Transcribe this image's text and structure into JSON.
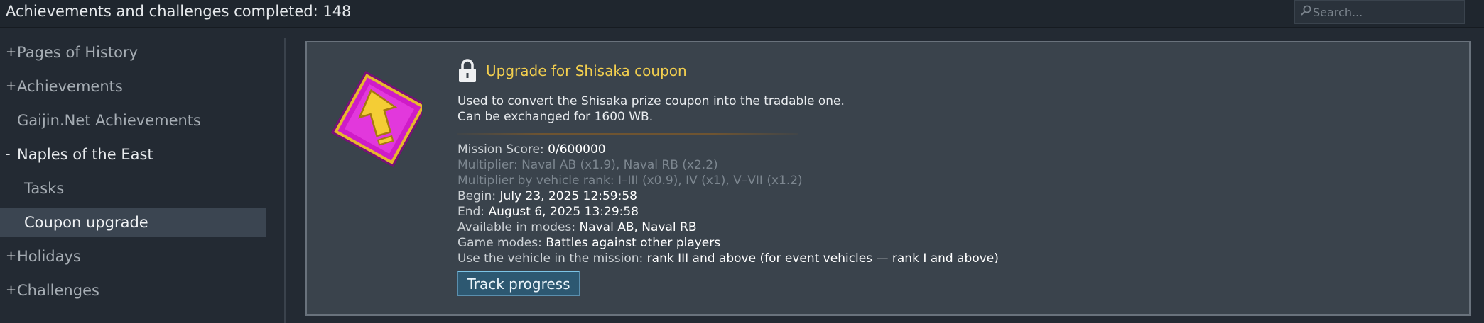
{
  "header": {
    "title": "Achievements and challenges completed: 148",
    "search_placeholder": "Search..."
  },
  "sidebar": {
    "items": [
      {
        "mark": "+",
        "label": "Pages of History"
      },
      {
        "mark": "+",
        "label": "Achievements"
      },
      {
        "mark": "",
        "label": "Gaijin.Net Achievements"
      },
      {
        "mark": "-",
        "label": "Naples of the East"
      },
      {
        "mark": "",
        "label": "Tasks"
      },
      {
        "mark": "",
        "label": "Coupon upgrade"
      },
      {
        "mark": "+",
        "label": "Holidays"
      },
      {
        "mark": "+",
        "label": "Challenges"
      }
    ],
    "selected": "Coupon upgrade"
  },
  "detail": {
    "title": "Upgrade for Shisaka coupon",
    "description": [
      "Used to convert the Shisaka prize coupon into the tradable one.",
      "Can be exchanged for 1600 WB."
    ],
    "mission_score": {
      "label": "Mission Score: ",
      "value": "0/600000"
    },
    "multiplier": "Multiplier: Naval AB (x1.9), Naval RB (x2.2)",
    "multiplier_rank": "Multiplier by vehicle rank: I–III (x0.9), IV (x1), V–VII (x1.2)",
    "begin": {
      "label": "Begin: ",
      "value": "July 23, 2025 12:59:58"
    },
    "end": {
      "label": "End: ",
      "value": "August 6, 2025 13:29:58"
    },
    "modes": {
      "label": "Available in modes: ",
      "value": "Naval AB, Naval RB"
    },
    "game_modes": {
      "label": "Game modes: ",
      "value": "Battles against other players"
    },
    "vehicle": {
      "label": "Use the vehicle in the mission: ",
      "value": "rank III and above (for event vehicles — rank I and above)"
    },
    "track_button": "Track progress",
    "status": "locked"
  },
  "icons": {
    "search": "search-icon",
    "lock": "lock-icon",
    "badge": "upgrade-arrow-badge-icon"
  },
  "colors": {
    "title_accent": "#f3cf4e",
    "badge_magenta": "#d21ac8",
    "badge_gold": "#f0c630",
    "button": "#2d5871"
  }
}
